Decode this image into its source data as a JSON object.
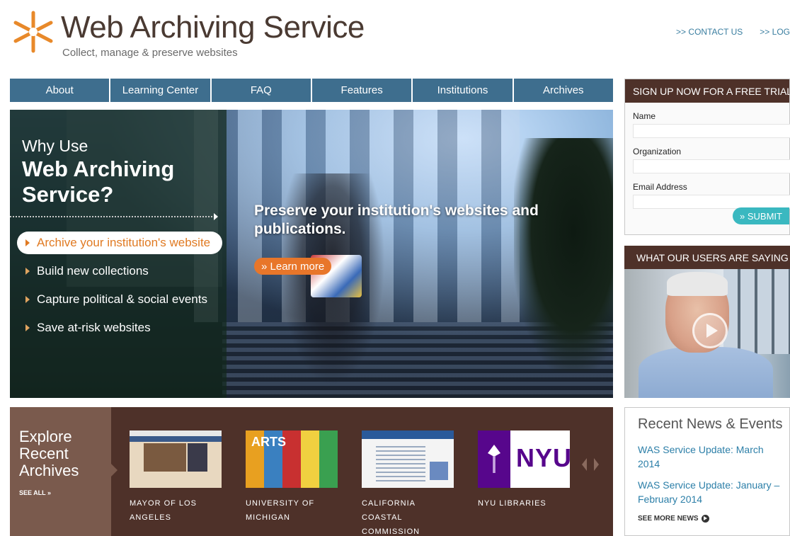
{
  "header": {
    "title": "Web Archiving Service",
    "tagline": "Collect, manage & preserve websites",
    "links": [
      ">> CONTACT US",
      ">> LOG"
    ]
  },
  "nav": [
    "About",
    "Learning Center",
    "FAQ",
    "Features",
    "Institutions",
    "Archives"
  ],
  "hero": {
    "why_small": "Why Use",
    "why_big": "Web Archiving Service?",
    "reasons": [
      "Archive your institution's website",
      "Build new collections",
      "Capture political & social events",
      "Save at-risk websites"
    ],
    "headline": "Preserve your institution's websites and publications.",
    "learn_more": "» Learn more"
  },
  "explore": {
    "title": "Explore Recent Archives",
    "see_all": "SEE ALL »",
    "thumb_text": {
      "arts": "ARTS",
      "nyu": "NYU"
    },
    "items": [
      {
        "caption": "MAYOR OF LOS ANGELES"
      },
      {
        "caption": "UNIVERSITY OF MICHIGAN"
      },
      {
        "caption": "CALIFORNIA COASTAL COMMISSION"
      },
      {
        "caption": "NYU LIBRARIES"
      }
    ]
  },
  "signup": {
    "heading": "SIGN UP NOW FOR A FREE TRIAL",
    "name_label": "Name",
    "org_label": "Organization",
    "email_label": "Email Address",
    "submit": "» SUBMIT"
  },
  "users": {
    "heading": "WHAT OUR USERS ARE SAYING"
  },
  "news": {
    "title": "Recent News & Events",
    "items": [
      "WAS Service Update: March 2014",
      "WAS Service Update: January – February 2014"
    ],
    "see_more": "SEE MORE NEWS"
  },
  "colors": {
    "nav_blue": "#3e6e8e",
    "brown": "#4e3129",
    "accent_orange": "#e8762a",
    "link_blue": "#2c7fa8",
    "submit_teal": "#3ab8c0"
  }
}
